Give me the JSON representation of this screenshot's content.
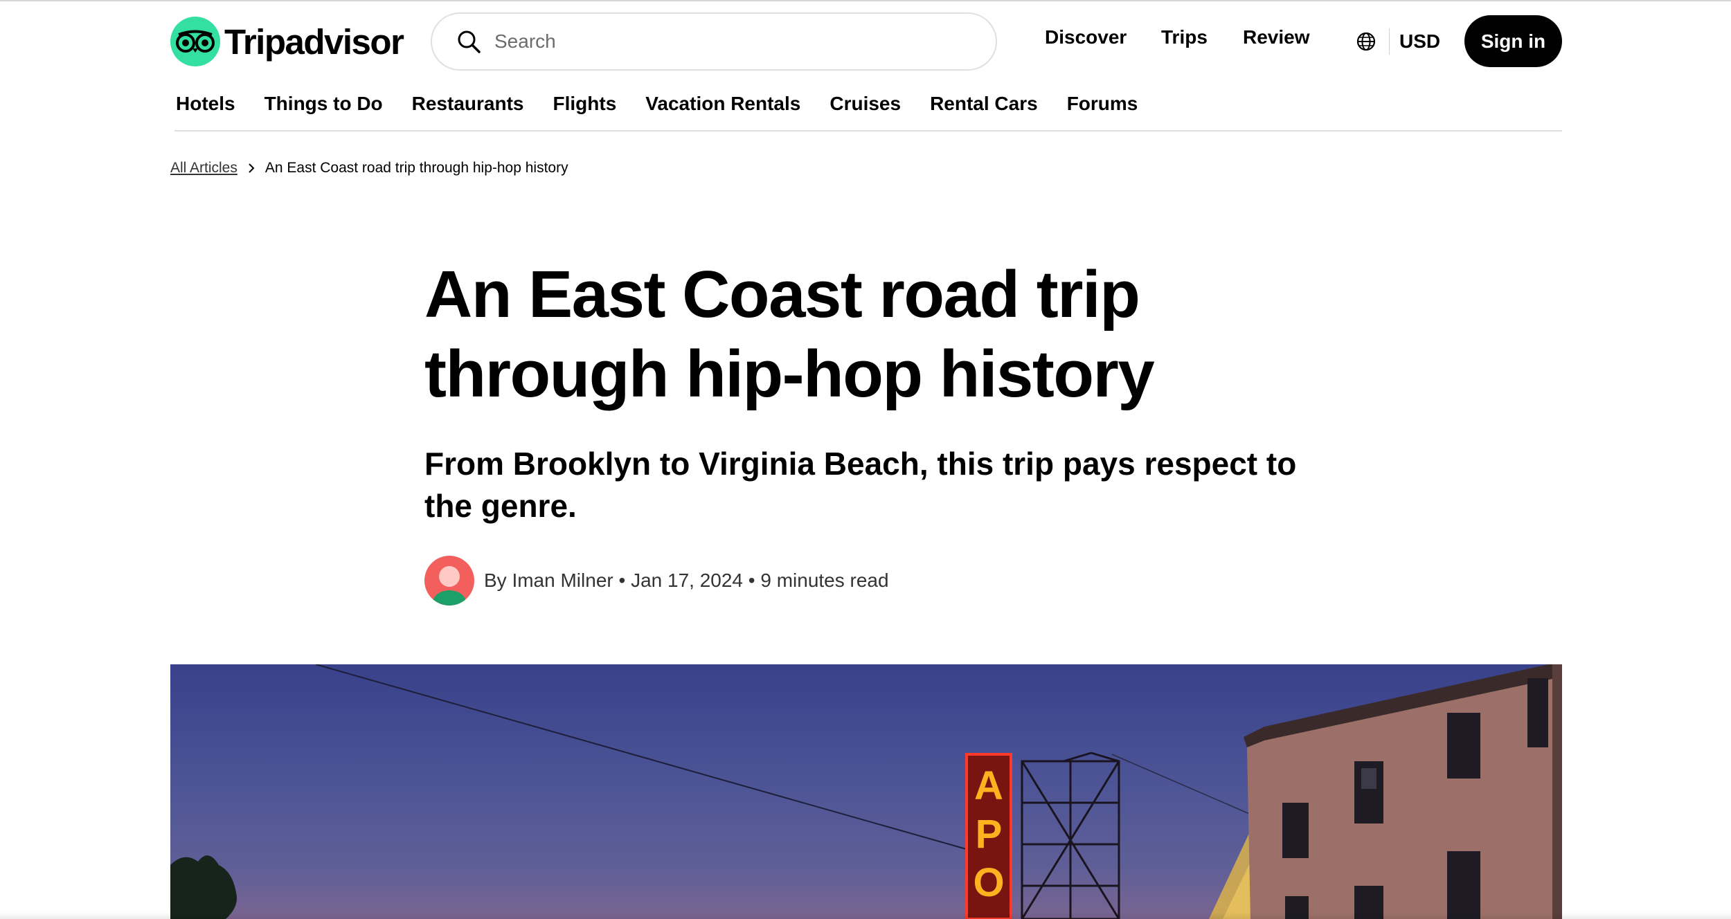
{
  "brand": {
    "name": "Tripadvisor",
    "accent": "#34e0a1"
  },
  "search": {
    "placeholder": "Search",
    "value": ""
  },
  "topnav": {
    "discover": "Discover",
    "trips": "Trips",
    "review": "Review",
    "currency": "USD",
    "signin": "Sign in"
  },
  "catnav": [
    "Hotels",
    "Things to Do",
    "Restaurants",
    "Flights",
    "Vacation Rentals",
    "Cruises",
    "Rental Cars",
    "Forums"
  ],
  "breadcrumb": {
    "parent": "All Articles",
    "current": "An East Coast road trip through hip-hop history"
  },
  "article": {
    "title_line1": "An East Coast road trip",
    "title_line2": "through hip-hop history",
    "subtitle": "From Brooklyn to Virginia Beach, this trip pays respect to the genre.",
    "byline": "By Iman Milner • Jan 17, 2024 • 9 minutes read"
  },
  "hero": {
    "sign_letters": [
      "A",
      "P",
      "O"
    ],
    "sign_color": "#ffb21f",
    "sky_color": "#3e4790"
  }
}
